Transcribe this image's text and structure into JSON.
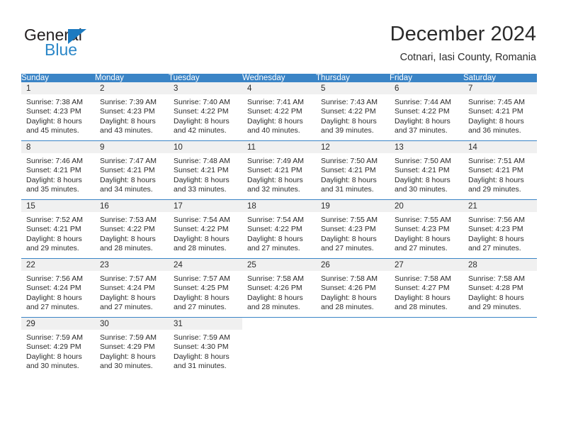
{
  "brand": {
    "name_top": "General",
    "name_bottom": "Blue",
    "accent_color": "#2b87c8",
    "triangle_color": "#1c7ac0"
  },
  "header": {
    "month_title": "December 2024",
    "location": "Cotnari, Iasi County, Romania"
  },
  "calendar": {
    "header_bg": "#3a84c6",
    "daynum_bg": "#f0f0f0",
    "weekday_headers": [
      "Sunday",
      "Monday",
      "Tuesday",
      "Wednesday",
      "Thursday",
      "Friday",
      "Saturday"
    ],
    "weeks": [
      [
        {
          "day": "1",
          "sunrise": "Sunrise: 7:38 AM",
          "sunset": "Sunset: 4:23 PM",
          "daylight1": "Daylight: 8 hours",
          "daylight2": "and 45 minutes."
        },
        {
          "day": "2",
          "sunrise": "Sunrise: 7:39 AM",
          "sunset": "Sunset: 4:23 PM",
          "daylight1": "Daylight: 8 hours",
          "daylight2": "and 43 minutes."
        },
        {
          "day": "3",
          "sunrise": "Sunrise: 7:40 AM",
          "sunset": "Sunset: 4:22 PM",
          "daylight1": "Daylight: 8 hours",
          "daylight2": "and 42 minutes."
        },
        {
          "day": "4",
          "sunrise": "Sunrise: 7:41 AM",
          "sunset": "Sunset: 4:22 PM",
          "daylight1": "Daylight: 8 hours",
          "daylight2": "and 40 minutes."
        },
        {
          "day": "5",
          "sunrise": "Sunrise: 7:43 AM",
          "sunset": "Sunset: 4:22 PM",
          "daylight1": "Daylight: 8 hours",
          "daylight2": "and 39 minutes."
        },
        {
          "day": "6",
          "sunrise": "Sunrise: 7:44 AM",
          "sunset": "Sunset: 4:22 PM",
          "daylight1": "Daylight: 8 hours",
          "daylight2": "and 37 minutes."
        },
        {
          "day": "7",
          "sunrise": "Sunrise: 7:45 AM",
          "sunset": "Sunset: 4:21 PM",
          "daylight1": "Daylight: 8 hours",
          "daylight2": "and 36 minutes."
        }
      ],
      [
        {
          "day": "8",
          "sunrise": "Sunrise: 7:46 AM",
          "sunset": "Sunset: 4:21 PM",
          "daylight1": "Daylight: 8 hours",
          "daylight2": "and 35 minutes."
        },
        {
          "day": "9",
          "sunrise": "Sunrise: 7:47 AM",
          "sunset": "Sunset: 4:21 PM",
          "daylight1": "Daylight: 8 hours",
          "daylight2": "and 34 minutes."
        },
        {
          "day": "10",
          "sunrise": "Sunrise: 7:48 AM",
          "sunset": "Sunset: 4:21 PM",
          "daylight1": "Daylight: 8 hours",
          "daylight2": "and 33 minutes."
        },
        {
          "day": "11",
          "sunrise": "Sunrise: 7:49 AM",
          "sunset": "Sunset: 4:21 PM",
          "daylight1": "Daylight: 8 hours",
          "daylight2": "and 32 minutes."
        },
        {
          "day": "12",
          "sunrise": "Sunrise: 7:50 AM",
          "sunset": "Sunset: 4:21 PM",
          "daylight1": "Daylight: 8 hours",
          "daylight2": "and 31 minutes."
        },
        {
          "day": "13",
          "sunrise": "Sunrise: 7:50 AM",
          "sunset": "Sunset: 4:21 PM",
          "daylight1": "Daylight: 8 hours",
          "daylight2": "and 30 minutes."
        },
        {
          "day": "14",
          "sunrise": "Sunrise: 7:51 AM",
          "sunset": "Sunset: 4:21 PM",
          "daylight1": "Daylight: 8 hours",
          "daylight2": "and 29 minutes."
        }
      ],
      [
        {
          "day": "15",
          "sunrise": "Sunrise: 7:52 AM",
          "sunset": "Sunset: 4:21 PM",
          "daylight1": "Daylight: 8 hours",
          "daylight2": "and 29 minutes."
        },
        {
          "day": "16",
          "sunrise": "Sunrise: 7:53 AM",
          "sunset": "Sunset: 4:22 PM",
          "daylight1": "Daylight: 8 hours",
          "daylight2": "and 28 minutes."
        },
        {
          "day": "17",
          "sunrise": "Sunrise: 7:54 AM",
          "sunset": "Sunset: 4:22 PM",
          "daylight1": "Daylight: 8 hours",
          "daylight2": "and 28 minutes."
        },
        {
          "day": "18",
          "sunrise": "Sunrise: 7:54 AM",
          "sunset": "Sunset: 4:22 PM",
          "daylight1": "Daylight: 8 hours",
          "daylight2": "and 27 minutes."
        },
        {
          "day": "19",
          "sunrise": "Sunrise: 7:55 AM",
          "sunset": "Sunset: 4:23 PM",
          "daylight1": "Daylight: 8 hours",
          "daylight2": "and 27 minutes."
        },
        {
          "day": "20",
          "sunrise": "Sunrise: 7:55 AM",
          "sunset": "Sunset: 4:23 PM",
          "daylight1": "Daylight: 8 hours",
          "daylight2": "and 27 minutes."
        },
        {
          "day": "21",
          "sunrise": "Sunrise: 7:56 AM",
          "sunset": "Sunset: 4:23 PM",
          "daylight1": "Daylight: 8 hours",
          "daylight2": "and 27 minutes."
        }
      ],
      [
        {
          "day": "22",
          "sunrise": "Sunrise: 7:56 AM",
          "sunset": "Sunset: 4:24 PM",
          "daylight1": "Daylight: 8 hours",
          "daylight2": "and 27 minutes."
        },
        {
          "day": "23",
          "sunrise": "Sunrise: 7:57 AM",
          "sunset": "Sunset: 4:24 PM",
          "daylight1": "Daylight: 8 hours",
          "daylight2": "and 27 minutes."
        },
        {
          "day": "24",
          "sunrise": "Sunrise: 7:57 AM",
          "sunset": "Sunset: 4:25 PM",
          "daylight1": "Daylight: 8 hours",
          "daylight2": "and 27 minutes."
        },
        {
          "day": "25",
          "sunrise": "Sunrise: 7:58 AM",
          "sunset": "Sunset: 4:26 PM",
          "daylight1": "Daylight: 8 hours",
          "daylight2": "and 28 minutes."
        },
        {
          "day": "26",
          "sunrise": "Sunrise: 7:58 AM",
          "sunset": "Sunset: 4:26 PM",
          "daylight1": "Daylight: 8 hours",
          "daylight2": "and 28 minutes."
        },
        {
          "day": "27",
          "sunrise": "Sunrise: 7:58 AM",
          "sunset": "Sunset: 4:27 PM",
          "daylight1": "Daylight: 8 hours",
          "daylight2": "and 28 minutes."
        },
        {
          "day": "28",
          "sunrise": "Sunrise: 7:58 AM",
          "sunset": "Sunset: 4:28 PM",
          "daylight1": "Daylight: 8 hours",
          "daylight2": "and 29 minutes."
        }
      ],
      [
        {
          "day": "29",
          "sunrise": "Sunrise: 7:59 AM",
          "sunset": "Sunset: 4:29 PM",
          "daylight1": "Daylight: 8 hours",
          "daylight2": "and 30 minutes."
        },
        {
          "day": "30",
          "sunrise": "Sunrise: 7:59 AM",
          "sunset": "Sunset: 4:29 PM",
          "daylight1": "Daylight: 8 hours",
          "daylight2": "and 30 minutes."
        },
        {
          "day": "31",
          "sunrise": "Sunrise: 7:59 AM",
          "sunset": "Sunset: 4:30 PM",
          "daylight1": "Daylight: 8 hours",
          "daylight2": "and 31 minutes."
        },
        {
          "day": "",
          "sunrise": "",
          "sunset": "",
          "daylight1": "",
          "daylight2": ""
        },
        {
          "day": "",
          "sunrise": "",
          "sunset": "",
          "daylight1": "",
          "daylight2": ""
        },
        {
          "day": "",
          "sunrise": "",
          "sunset": "",
          "daylight1": "",
          "daylight2": ""
        },
        {
          "day": "",
          "sunrise": "",
          "sunset": "",
          "daylight1": "",
          "daylight2": ""
        }
      ]
    ]
  }
}
